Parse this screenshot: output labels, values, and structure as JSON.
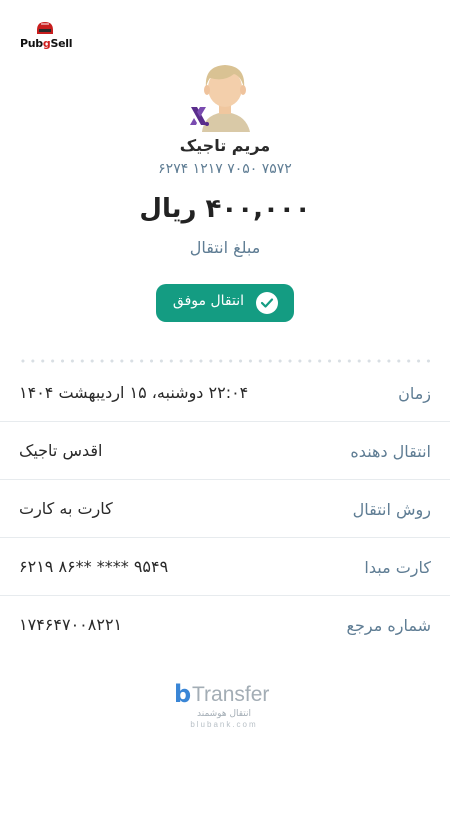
{
  "brand": {
    "logo_text_a": "Pub",
    "logo_text_b": "g",
    "logo_text_c": "Sell"
  },
  "recipient": {
    "name": "مریم تاجیک",
    "card_number": "۶۲۷۴  ۱۲۱۷  ۷۰۵۰  ۷۵۷۲"
  },
  "amount": {
    "value": "۴۰۰,۰۰۰ ریال",
    "label": "مبلغ انتقال"
  },
  "status": {
    "text": "انتقال موفق",
    "color": "#149c82"
  },
  "details": [
    {
      "label": "زمان",
      "value": "۲۲:۰۴ دوشنبه، ۱۵ اردیبهشت ۱۴۰۴"
    },
    {
      "label": "انتقال دهنده",
      "value": "اقدس تاجیک"
    },
    {
      "label": "روش انتقال",
      "value": "کارت به کارت"
    },
    {
      "label": "کارت مبدا",
      "value": "۶۲۱۹  ۸۶** ****  ۹۵۴۹"
    },
    {
      "label": "شماره مرجع",
      "value": "۱۷۴۶۴۷۰۰۸۲۲۱"
    }
  ],
  "footer": {
    "brand_b": "b",
    "brand_t": "Transfer",
    "tagline": "انتقال هوشمند",
    "url": "blubank.com"
  }
}
